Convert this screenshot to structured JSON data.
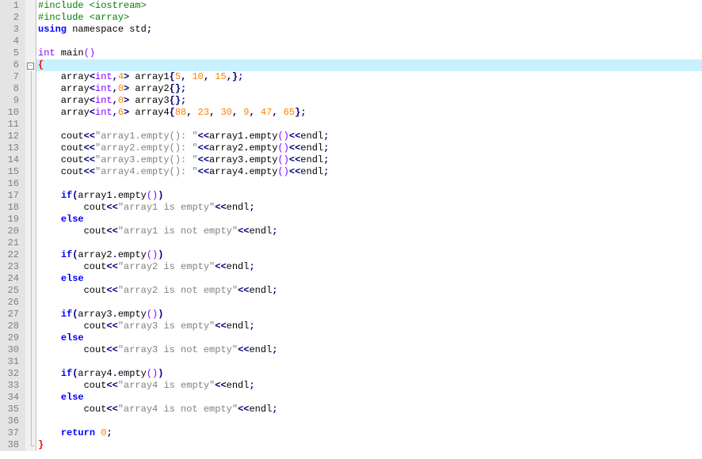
{
  "lines": [
    {
      "n": 1,
      "fold": "",
      "hl": false,
      "tokens": [
        [
          "pp",
          "#include <iostream>"
        ]
      ]
    },
    {
      "n": 2,
      "fold": "",
      "hl": false,
      "tokens": [
        [
          "pp",
          "#include <array>"
        ]
      ]
    },
    {
      "n": 3,
      "fold": "",
      "hl": false,
      "tokens": [
        [
          "kw",
          "using "
        ],
        [
          "pn",
          "namespace std"
        ],
        [
          "op",
          ";"
        ]
      ]
    },
    {
      "n": 4,
      "fold": "",
      "hl": false,
      "tokens": [
        [
          "pn",
          ""
        ]
      ]
    },
    {
      "n": 5,
      "fold": "",
      "hl": false,
      "tokens": [
        [
          "ty",
          "int"
        ],
        [
          "pn",
          " main"
        ],
        [
          "pc",
          "()"
        ]
      ]
    },
    {
      "n": 6,
      "fold": "box",
      "hl": true,
      "tokens": [
        [
          "br1",
          "{"
        ]
      ]
    },
    {
      "n": 7,
      "fold": "line",
      "hl": false,
      "tokens": [
        [
          "pn",
          "    array"
        ],
        [
          "op",
          "<"
        ],
        [
          "ty",
          "int"
        ],
        [
          "op",
          ","
        ],
        [
          "nu",
          "4"
        ],
        [
          "op",
          ">"
        ],
        [
          "pn",
          " array1"
        ],
        [
          "op",
          "{"
        ],
        [
          "nu",
          "5"
        ],
        [
          "op",
          ", "
        ],
        [
          "nu",
          "10"
        ],
        [
          "op",
          ", "
        ],
        [
          "nu",
          "15"
        ],
        [
          "op",
          ",};"
        ]
      ]
    },
    {
      "n": 8,
      "fold": "line",
      "hl": false,
      "tokens": [
        [
          "pn",
          "    array"
        ],
        [
          "op",
          "<"
        ],
        [
          "ty",
          "int"
        ],
        [
          "op",
          ","
        ],
        [
          "nu",
          "0"
        ],
        [
          "op",
          ">"
        ],
        [
          "pn",
          " array2"
        ],
        [
          "op",
          "{};"
        ]
      ]
    },
    {
      "n": 9,
      "fold": "line",
      "hl": false,
      "tokens": [
        [
          "pn",
          "    array"
        ],
        [
          "op",
          "<"
        ],
        [
          "ty",
          "int"
        ],
        [
          "op",
          ","
        ],
        [
          "nu",
          "0"
        ],
        [
          "op",
          ">"
        ],
        [
          "pn",
          " array3"
        ],
        [
          "op",
          "{};"
        ]
      ]
    },
    {
      "n": 10,
      "fold": "line",
      "hl": false,
      "tokens": [
        [
          "pn",
          "    array"
        ],
        [
          "op",
          "<"
        ],
        [
          "ty",
          "int"
        ],
        [
          "op",
          ","
        ],
        [
          "nu",
          "6"
        ],
        [
          "op",
          ">"
        ],
        [
          "pn",
          " array4"
        ],
        [
          "op",
          "{"
        ],
        [
          "nu",
          "88"
        ],
        [
          "op",
          ", "
        ],
        [
          "nu",
          "23"
        ],
        [
          "op",
          ", "
        ],
        [
          "nu",
          "30"
        ],
        [
          "op",
          ", "
        ],
        [
          "nu",
          "9"
        ],
        [
          "op",
          ", "
        ],
        [
          "nu",
          "47"
        ],
        [
          "op",
          ", "
        ],
        [
          "nu",
          "65"
        ],
        [
          "op",
          "};"
        ]
      ]
    },
    {
      "n": 11,
      "fold": "line",
      "hl": false,
      "tokens": [
        [
          "pn",
          ""
        ]
      ]
    },
    {
      "n": 12,
      "fold": "line",
      "hl": false,
      "tokens": [
        [
          "pn",
          "    cout"
        ],
        [
          "op",
          "<<"
        ],
        [
          "st",
          "\"array1.empty(): \""
        ],
        [
          "op",
          "<<"
        ],
        [
          "pn",
          "array1"
        ],
        [
          "op",
          "."
        ],
        [
          "fn",
          "empty"
        ],
        [
          "pc",
          "()"
        ],
        [
          "op",
          "<<"
        ],
        [
          "pn",
          "endl"
        ],
        [
          "op",
          ";"
        ]
      ]
    },
    {
      "n": 13,
      "fold": "line",
      "hl": false,
      "tokens": [
        [
          "pn",
          "    cout"
        ],
        [
          "op",
          "<<"
        ],
        [
          "st",
          "\"array2.empty(): \""
        ],
        [
          "op",
          "<<"
        ],
        [
          "pn",
          "array2"
        ],
        [
          "op",
          "."
        ],
        [
          "fn",
          "empty"
        ],
        [
          "pc",
          "()"
        ],
        [
          "op",
          "<<"
        ],
        [
          "pn",
          "endl"
        ],
        [
          "op",
          ";"
        ]
      ]
    },
    {
      "n": 14,
      "fold": "line",
      "hl": false,
      "tokens": [
        [
          "pn",
          "    cout"
        ],
        [
          "op",
          "<<"
        ],
        [
          "st",
          "\"array3.empty(): \""
        ],
        [
          "op",
          "<<"
        ],
        [
          "pn",
          "array3"
        ],
        [
          "op",
          "."
        ],
        [
          "fn",
          "empty"
        ],
        [
          "pc",
          "()"
        ],
        [
          "op",
          "<<"
        ],
        [
          "pn",
          "endl"
        ],
        [
          "op",
          ";"
        ]
      ]
    },
    {
      "n": 15,
      "fold": "line",
      "hl": false,
      "tokens": [
        [
          "pn",
          "    cout"
        ],
        [
          "op",
          "<<"
        ],
        [
          "st",
          "\"array4.empty(): \""
        ],
        [
          "op",
          "<<"
        ],
        [
          "pn",
          "array4"
        ],
        [
          "op",
          "."
        ],
        [
          "fn",
          "empty"
        ],
        [
          "pc",
          "()"
        ],
        [
          "op",
          "<<"
        ],
        [
          "pn",
          "endl"
        ],
        [
          "op",
          ";"
        ]
      ]
    },
    {
      "n": 16,
      "fold": "line",
      "hl": false,
      "tokens": [
        [
          "pn",
          ""
        ]
      ]
    },
    {
      "n": 17,
      "fold": "line",
      "hl": false,
      "tokens": [
        [
          "pn",
          "    "
        ],
        [
          "kw",
          "if"
        ],
        [
          "op",
          "("
        ],
        [
          "pn",
          "array1"
        ],
        [
          "op",
          "."
        ],
        [
          "fn",
          "empty"
        ],
        [
          "pc",
          "()"
        ],
        [
          "op",
          ")"
        ]
      ]
    },
    {
      "n": 18,
      "fold": "line",
      "hl": false,
      "tokens": [
        [
          "pn",
          "        cout"
        ],
        [
          "op",
          "<<"
        ],
        [
          "st",
          "\"array1 is empty\""
        ],
        [
          "op",
          "<<"
        ],
        [
          "pn",
          "endl"
        ],
        [
          "op",
          ";"
        ]
      ]
    },
    {
      "n": 19,
      "fold": "line",
      "hl": false,
      "tokens": [
        [
          "pn",
          "    "
        ],
        [
          "kw",
          "else"
        ]
      ]
    },
    {
      "n": 20,
      "fold": "line",
      "hl": false,
      "tokens": [
        [
          "pn",
          "        cout"
        ],
        [
          "op",
          "<<"
        ],
        [
          "st",
          "\"array1 is not empty\""
        ],
        [
          "op",
          "<<"
        ],
        [
          "pn",
          "endl"
        ],
        [
          "op",
          ";"
        ]
      ]
    },
    {
      "n": 21,
      "fold": "line",
      "hl": false,
      "tokens": [
        [
          "pn",
          ""
        ]
      ]
    },
    {
      "n": 22,
      "fold": "line",
      "hl": false,
      "tokens": [
        [
          "pn",
          "    "
        ],
        [
          "kw",
          "if"
        ],
        [
          "op",
          "("
        ],
        [
          "pn",
          "array2"
        ],
        [
          "op",
          "."
        ],
        [
          "fn",
          "empty"
        ],
        [
          "pc",
          "()"
        ],
        [
          "op",
          ")"
        ]
      ]
    },
    {
      "n": 23,
      "fold": "line",
      "hl": false,
      "tokens": [
        [
          "pn",
          "        cout"
        ],
        [
          "op",
          "<<"
        ],
        [
          "st",
          "\"array2 is empty\""
        ],
        [
          "op",
          "<<"
        ],
        [
          "pn",
          "endl"
        ],
        [
          "op",
          ";"
        ]
      ]
    },
    {
      "n": 24,
      "fold": "line",
      "hl": false,
      "tokens": [
        [
          "pn",
          "    "
        ],
        [
          "kw",
          "else"
        ]
      ]
    },
    {
      "n": 25,
      "fold": "line",
      "hl": false,
      "tokens": [
        [
          "pn",
          "        cout"
        ],
        [
          "op",
          "<<"
        ],
        [
          "st",
          "\"array2 is not empty\""
        ],
        [
          "op",
          "<<"
        ],
        [
          "pn",
          "endl"
        ],
        [
          "op",
          ";"
        ]
      ]
    },
    {
      "n": 26,
      "fold": "line",
      "hl": false,
      "tokens": [
        [
          "pn",
          ""
        ]
      ]
    },
    {
      "n": 27,
      "fold": "line",
      "hl": false,
      "tokens": [
        [
          "pn",
          "    "
        ],
        [
          "kw",
          "if"
        ],
        [
          "op",
          "("
        ],
        [
          "pn",
          "array3"
        ],
        [
          "op",
          "."
        ],
        [
          "fn",
          "empty"
        ],
        [
          "pc",
          "()"
        ],
        [
          "op",
          ")"
        ]
      ]
    },
    {
      "n": 28,
      "fold": "line",
      "hl": false,
      "tokens": [
        [
          "pn",
          "        cout"
        ],
        [
          "op",
          "<<"
        ],
        [
          "st",
          "\"array3 is empty\""
        ],
        [
          "op",
          "<<"
        ],
        [
          "pn",
          "endl"
        ],
        [
          "op",
          ";"
        ]
      ]
    },
    {
      "n": 29,
      "fold": "line",
      "hl": false,
      "tokens": [
        [
          "pn",
          "    "
        ],
        [
          "kw",
          "else"
        ]
      ]
    },
    {
      "n": 30,
      "fold": "line",
      "hl": false,
      "tokens": [
        [
          "pn",
          "        cout"
        ],
        [
          "op",
          "<<"
        ],
        [
          "st",
          "\"array3 is not empty\""
        ],
        [
          "op",
          "<<"
        ],
        [
          "pn",
          "endl"
        ],
        [
          "op",
          ";"
        ]
      ]
    },
    {
      "n": 31,
      "fold": "line",
      "hl": false,
      "tokens": [
        [
          "pn",
          ""
        ]
      ]
    },
    {
      "n": 32,
      "fold": "line",
      "hl": false,
      "tokens": [
        [
          "pn",
          "    "
        ],
        [
          "kw",
          "if"
        ],
        [
          "op",
          "("
        ],
        [
          "pn",
          "array4"
        ],
        [
          "op",
          "."
        ],
        [
          "fn",
          "empty"
        ],
        [
          "pc",
          "()"
        ],
        [
          "op",
          ")"
        ]
      ]
    },
    {
      "n": 33,
      "fold": "line",
      "hl": false,
      "tokens": [
        [
          "pn",
          "        cout"
        ],
        [
          "op",
          "<<"
        ],
        [
          "st",
          "\"array4 is empty\""
        ],
        [
          "op",
          "<<"
        ],
        [
          "pn",
          "endl"
        ],
        [
          "op",
          ";"
        ]
      ]
    },
    {
      "n": 34,
      "fold": "line",
      "hl": false,
      "tokens": [
        [
          "pn",
          "    "
        ],
        [
          "kw",
          "else"
        ]
      ]
    },
    {
      "n": 35,
      "fold": "line",
      "hl": false,
      "tokens": [
        [
          "pn",
          "        cout"
        ],
        [
          "op",
          "<<"
        ],
        [
          "st",
          "\"array4 is not empty\""
        ],
        [
          "op",
          "<<"
        ],
        [
          "pn",
          "endl"
        ],
        [
          "op",
          ";"
        ]
      ]
    },
    {
      "n": 36,
      "fold": "line",
      "hl": false,
      "tokens": [
        [
          "pn",
          ""
        ]
      ]
    },
    {
      "n": 37,
      "fold": "line",
      "hl": false,
      "tokens": [
        [
          "pn",
          "    "
        ],
        [
          "kw",
          "return"
        ],
        [
          "pn",
          " "
        ],
        [
          "nu",
          "0"
        ],
        [
          "op",
          ";"
        ]
      ]
    },
    {
      "n": 38,
      "fold": "end",
      "hl": false,
      "tokens": [
        [
          "br1",
          "}"
        ]
      ]
    }
  ]
}
